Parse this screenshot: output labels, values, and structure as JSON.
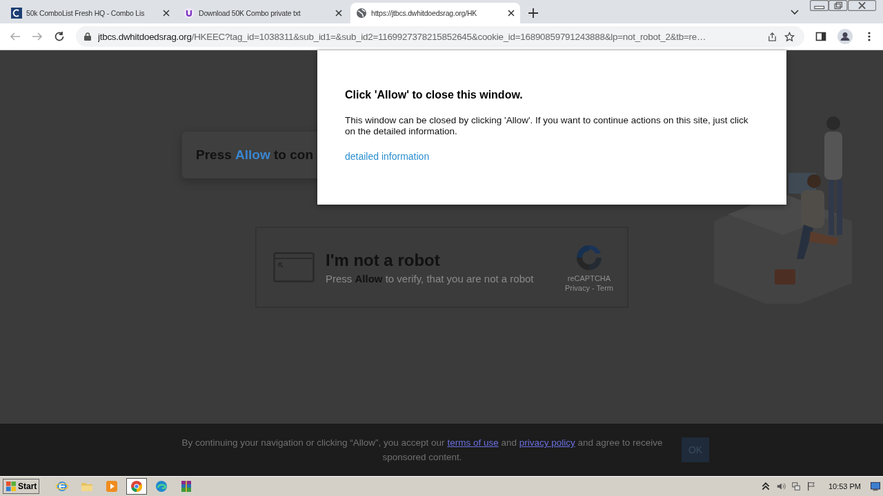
{
  "tabs": [
    {
      "title": "50k ComboList Fresh HQ - Combo Lis",
      "kind": "letter",
      "selected": false
    },
    {
      "title": "Download 50K Combo private txt",
      "kind": "u-logo",
      "selected": false
    },
    {
      "title": "https://jtbcs.dwhitdoedsrag.org/HK",
      "kind": "globe",
      "selected": true
    }
  ],
  "address_bar": {
    "host": "jtbcs.dwhitdoedsrag.org",
    "path": "/HKEEC?tag_id=1038311&sub_id1=&sub_id2=1169927378215852645&cookie_id=16890859791243888&lp=not_robot_2&tb=re…"
  },
  "page": {
    "banner": "Press **Allow** to con",
    "captcha": {
      "title": "I'm not a robot",
      "subtitle": "Press **Allow** to verify, that you are not a robot",
      "brand": "reCAPTCHA",
      "links": "Privacy - Term"
    }
  },
  "popup": {
    "title": "Click 'Allow' to close this window.",
    "body": "This window can be closed by clicking 'Allow'. If you want to continue actions on this site, just click on the detailed information.",
    "link": "detailed information"
  },
  "consent": {
    "text_before": "By continuing your navigation or clicking “Allow”, you accept our",
    "terms_link": "terms of use",
    "middle": "and",
    "privacy_link": "privacy policy",
    "text_after": "and agree to receive sponsored content.",
    "button": "OK"
  },
  "taskbar": {
    "start": "Start",
    "apps": [
      {
        "kind": "ie",
        "selected": false
      },
      {
        "kind": "folder",
        "selected": false
      },
      {
        "kind": "media",
        "selected": false
      },
      {
        "kind": "chrome",
        "selected": true
      },
      {
        "kind": "edge",
        "selected": false
      },
      {
        "kind": "archive",
        "selected": false
      }
    ],
    "clock": "10:53 PM"
  }
}
